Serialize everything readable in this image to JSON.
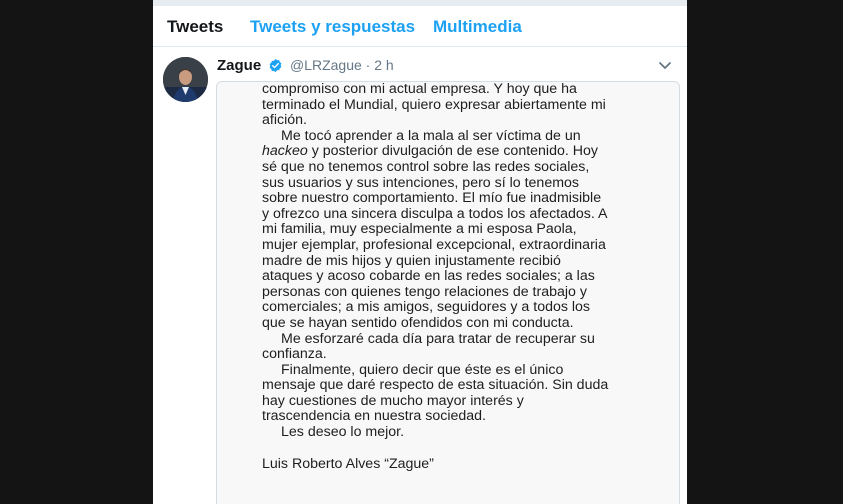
{
  "tabs": [
    {
      "label": "Tweets",
      "active": true
    },
    {
      "label": "Tweets y respuestas",
      "active": false
    },
    {
      "label": "Multimedia",
      "active": false
    }
  ],
  "tweet": {
    "name": "Zague",
    "handle": "@LRZague",
    "separator": "·",
    "time": "2 h",
    "icons": {
      "verified": "verified-badge-icon",
      "caret": "chevron-down-icon"
    },
    "letter": {
      "lines": [
        "compromiso con mi actual empresa. Y hoy que ha",
        "terminado el Mundial, quiero expresar abiertamente mi",
        "afición.",
        "Me tocó aprender a la mala al ser víctima de un",
        "hackeo",
        " y posterior divulgación de ese contenido. Hoy",
        "sé que no tenemos control sobre las redes sociales,",
        "sus usuarios y sus intenciones, pero sí lo tenemos",
        "sobre nuestro comportamiento. El mío fue inadmisible",
        "y ofrezco una sincera disculpa a todos los afectados. A",
        "mi familia, muy especialmente a mi esposa Paola,",
        "mujer ejemplar, profesional excepcional, extraordinaria",
        "madre de mis hijos y quien injustamente recibió",
        "ataques y acoso cobarde en las redes sociales; a las",
        "personas con quienes tengo relaciones de trabajo y",
        "comerciales; a mis amigos, seguidores y a todos los",
        "que se hayan sentido ofendidos con mi conducta.",
        "Me esforzaré cada día para tratar de recuperar su",
        "confianza.",
        "Finalmente, quiero decir que éste es el único",
        "mensaje que daré respecto de esta situación. Sin duda",
        "hay cuestiones de mucho mayor interés y",
        "trascendencia en nuestra sociedad.",
        "Les deseo lo mejor.",
        "Luis Roberto Alves “Zague”"
      ]
    }
  },
  "colors": {
    "accent": "#1da1f2",
    "text": "#14171a",
    "muted": "#657786",
    "page_bg": "#141414"
  }
}
